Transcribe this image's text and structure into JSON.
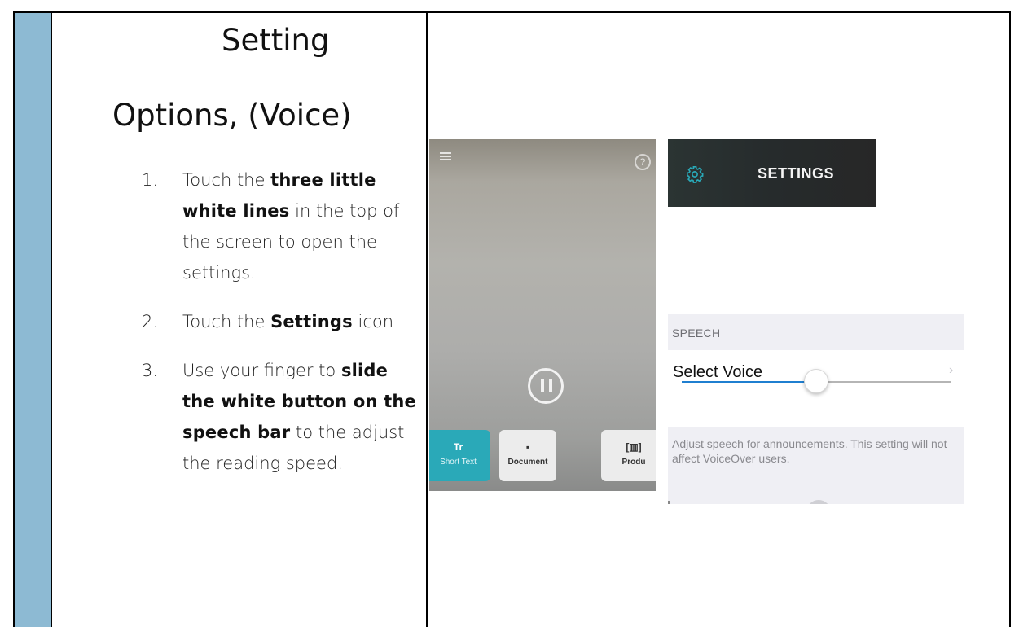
{
  "document": {
    "heading_line1": "Setting",
    "heading_line2": "Options, (Voice)",
    "steps": [
      {
        "number": "1.",
        "parts": [
          "Touch the ",
          "three little white lines",
          " in the top of the screen to open the settings."
        ]
      },
      {
        "number": "2.",
        "parts": [
          "Touch the ",
          "Settings",
          " icon"
        ]
      },
      {
        "number": "3.",
        "parts": [
          "Use your finger to ",
          "slide the white button on the speech bar",
          " to the adjust the reading speed."
        ]
      }
    ]
  },
  "camera_screen": {
    "menu_icon": "hamburger-menu-icon",
    "help_icon": "help-circle-icon",
    "pause_icon": "pause-icon",
    "tabs": [
      {
        "glyph": "Tr",
        "label": "Short Text",
        "active": true
      },
      {
        "glyph": "▪",
        "label": "Document",
        "active": false
      },
      {
        "glyph": "[▥]",
        "label": "Produ",
        "active": false
      }
    ],
    "accent_color": "#2aa9b8"
  },
  "settings_header": {
    "icon": "gear-icon",
    "title": "SETTINGS",
    "icon_color": "#29a9b8"
  },
  "speech_settings": {
    "section_header": "SPEECH",
    "select_voice_label": "Select Voice",
    "chevron": "›",
    "speech_rate_fraction": 0.5,
    "slider_color": "#1f7fd0",
    "description": "Adjust speech for announcements. This setting will not affect VoiceOver users."
  },
  "colors": {
    "side_column": "#8dbad3"
  }
}
